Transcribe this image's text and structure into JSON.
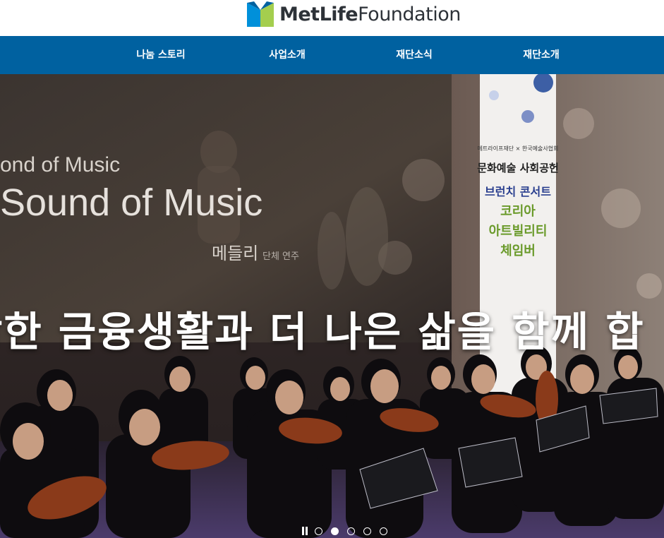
{
  "brand": {
    "name_bold": "MetLife",
    "name_light": "Foundation",
    "logo_colors": [
      "#a4ce4e",
      "#0090da",
      "#0061a0"
    ]
  },
  "nav": {
    "items": [
      {
        "label": "나눔 스토리"
      },
      {
        "label": "사업소개"
      },
      {
        "label": "재단소식"
      },
      {
        "label": "재단소개"
      }
    ],
    "background": "#0061a0"
  },
  "hero": {
    "headline": "강한 금융생활과 더 나은 삶을 함께 합",
    "screen_text_small": "ond of Music",
    "screen_text_large": "Sound of Music",
    "screen_text_sub": "메들리",
    "screen_text_sub2": "단체 연주",
    "banner": {
      "top_line": "메트라이프재단 × 한국예술사협회",
      "lines": [
        "문화예술 사회공헌",
        "브런치 콘서트",
        "코리아",
        "아트빌리티",
        "체임버"
      ]
    }
  },
  "slider": {
    "pause_icon": "pause-icon",
    "dots": [
      false,
      true,
      false,
      false,
      false
    ]
  }
}
